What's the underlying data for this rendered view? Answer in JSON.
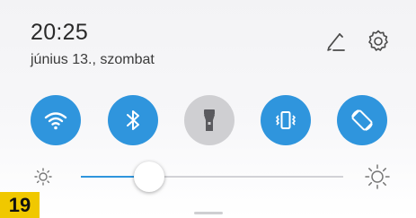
{
  "status": {
    "time": "20:25",
    "date": "június 13., szombat"
  },
  "header_icons": [
    "edit-icon",
    "settings-gear-icon"
  ],
  "quick_toggles": [
    {
      "icon": "wifi-icon",
      "state": "on"
    },
    {
      "icon": "bluetooth-icon",
      "state": "on"
    },
    {
      "icon": "flashlight-icon",
      "state": "off"
    },
    {
      "icon": "vibrate-icon",
      "state": "on"
    },
    {
      "icon": "auto-rotate-icon",
      "state": "on"
    }
  ],
  "brightness": {
    "level": 0.26
  },
  "badge": {
    "label": "19"
  },
  "colors": {
    "accent": "#2f95dd",
    "inactive": "#cfcfd2",
    "badge": "#f0c800"
  }
}
